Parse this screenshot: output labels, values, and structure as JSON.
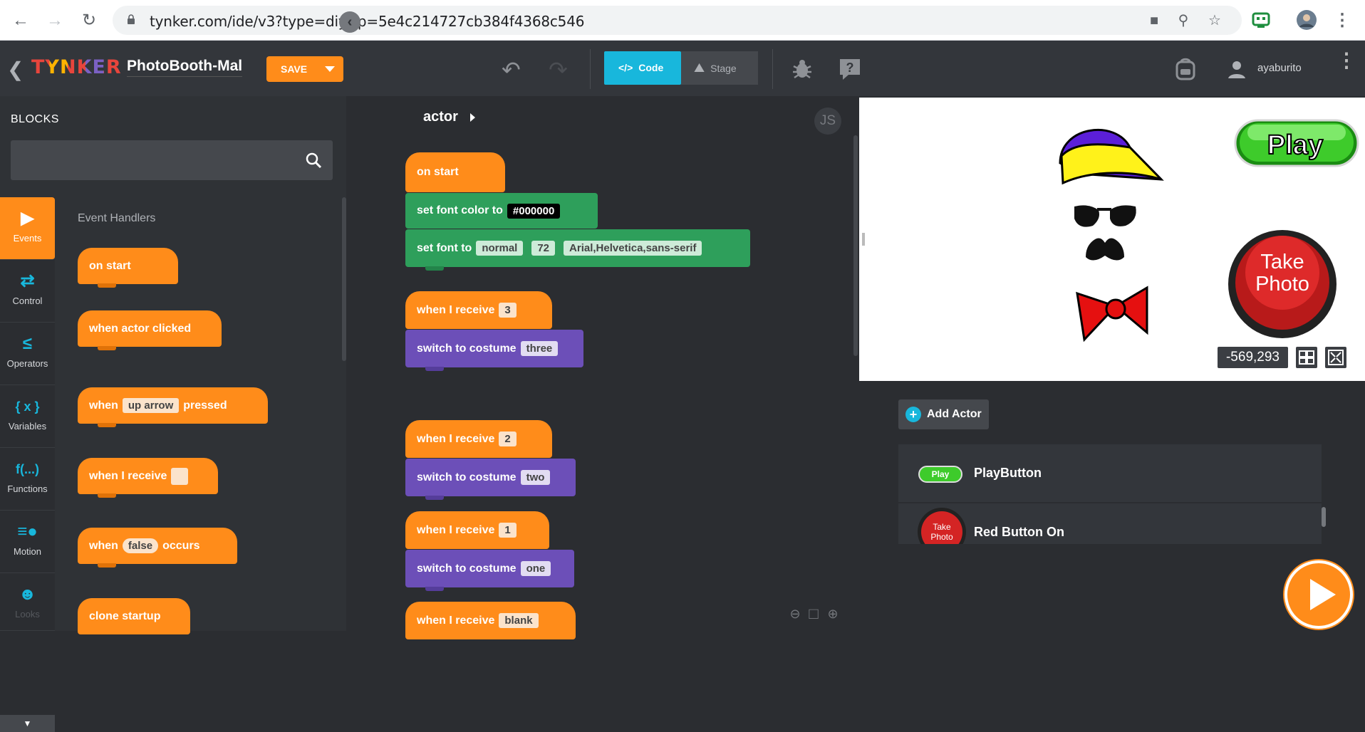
{
  "browser": {
    "url": "tynker.com/ide/v3?type=diy&p=5e4c214727cb384f4368c546"
  },
  "header": {
    "logo": "TYNKER",
    "project_title": "PhotoBooth-Mal",
    "save_label": "SAVE",
    "tab_code": "Code",
    "tab_stage": "Stage",
    "username": "ayaburito"
  },
  "blocks_panel": {
    "title": "BLOCKS",
    "search_placeholder": "",
    "section_label": "Event Handlers",
    "categories": [
      {
        "label": "Events",
        "icon": "play-triangle-icon"
      },
      {
        "label": "Control",
        "icon": "loop-arrows-icon"
      },
      {
        "label": "Operators",
        "icon": "less-equal-icon"
      },
      {
        "label": "Variables",
        "icon": "braces-x-icon"
      },
      {
        "label": "Functions",
        "icon": "function-icon"
      },
      {
        "label": "Motion",
        "icon": "motion-icon"
      },
      {
        "label": "Looks",
        "icon": "mask-icon"
      }
    ],
    "blocks": {
      "on_start": "on start",
      "when_actor_clicked": "when actor clicked",
      "when_key_pre": "when",
      "when_key_slot": "up arrow",
      "when_key_post": "pressed",
      "when_receive": "when I receive",
      "when_occurs_pre": "when",
      "when_occurs_slot": "false",
      "when_occurs_post": "occurs",
      "clone_startup": "clone startup"
    }
  },
  "code": {
    "actor": "actor",
    "js_label": "JS",
    "on_start": "on start",
    "set_font_color": "set font color to",
    "font_color_value": "#000000",
    "set_font": "set font to",
    "font_style": "normal",
    "font_size": "72",
    "font_family": "Arial,Helvetica,sans-serif",
    "when_receive": "when I receive",
    "switch_costume": "switch to costume",
    "scripts": [
      {
        "message": "3",
        "costume": "three"
      },
      {
        "message": "2",
        "costume": "two"
      },
      {
        "message": "1",
        "costume": "one"
      },
      {
        "message": "blank"
      }
    ]
  },
  "stage": {
    "play_label": "Play",
    "take_photo_label_1": "Take",
    "take_photo_label_2": "Photo",
    "coords": "-569,293"
  },
  "actors_panel": {
    "add_actor": "Add Actor",
    "actors": [
      {
        "name": "PlayButton",
        "thumb_label": "Play"
      },
      {
        "name": "Red Button On",
        "thumb_label_1": "Take",
        "thumb_label_2": "Photo"
      }
    ]
  },
  "colors": {
    "events_orange": "#ff8c1a",
    "looks_purple": "#6c4fb8",
    "font_green": "#2e9f5b",
    "accent_cyan": "#18b7dc"
  }
}
